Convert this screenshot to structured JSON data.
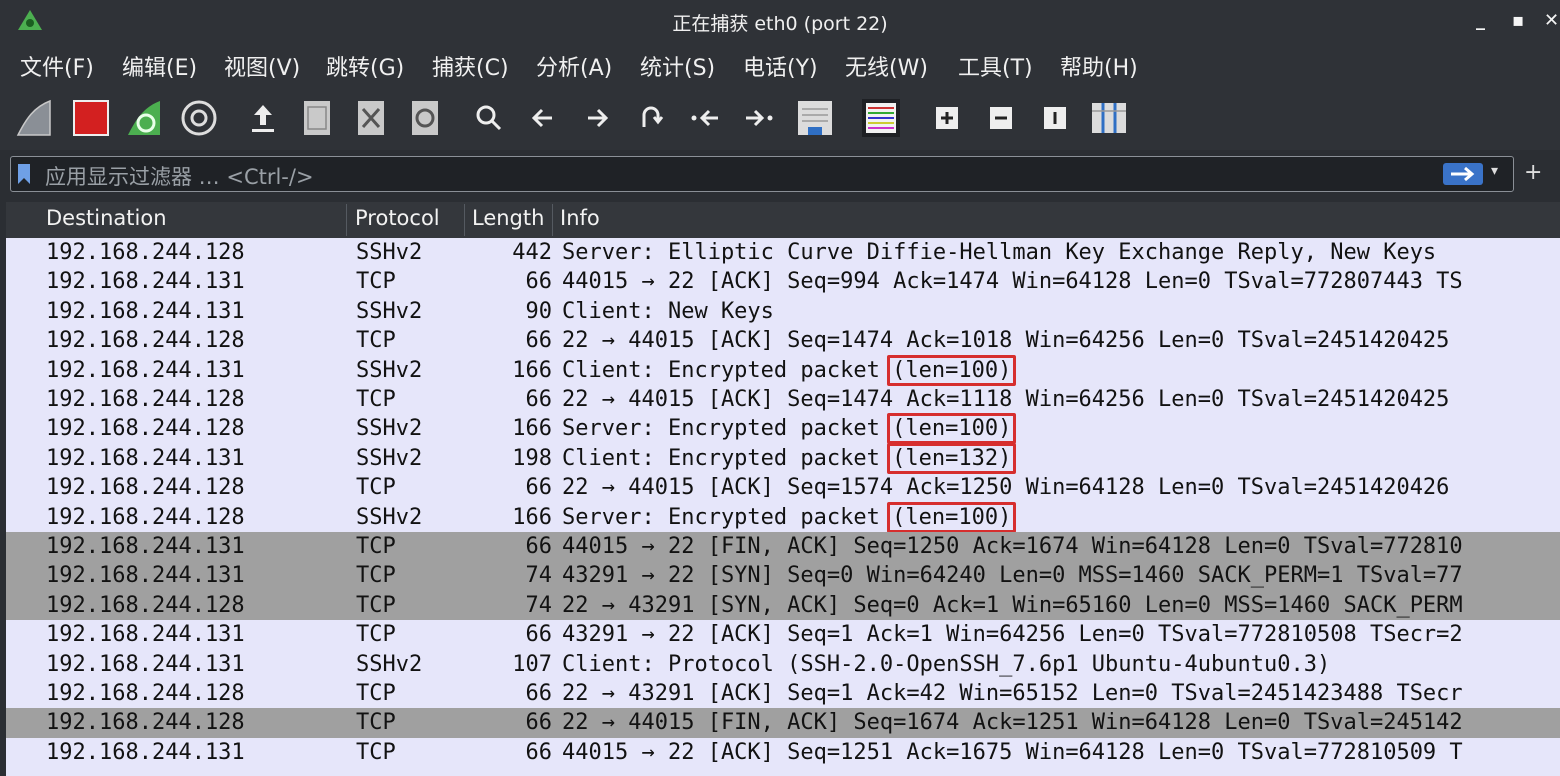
{
  "window": {
    "title": "正在捕获 eth0 (port 22)",
    "controls": {
      "minimize": "_",
      "maximize": "▪",
      "close": "✕"
    }
  },
  "menu": [
    "文件(F)",
    "编辑(E)",
    "视图(V)",
    "跳转(G)",
    "捕获(C)",
    "分析(A)",
    "统计(S)",
    "电话(Y)",
    "无线(W)",
    "工具(T)",
    "帮助(H)"
  ],
  "toolbar": [
    "shark-fin-icon",
    "stop-capture-icon",
    "restart-capture-icon",
    "capture-options-icon",
    "open-file-icon",
    "save-file-icon",
    "close-file-icon",
    "reload-file-icon",
    "find-packet-icon",
    "go-back-icon",
    "go-forward-icon",
    "go-to-packet-icon",
    "go-first-packet-icon",
    "go-last-packet-icon",
    "auto-scroll-icon",
    "colorize-icon",
    "zoom-in-icon",
    "zoom-out-icon",
    "normal-size-icon",
    "resize-columns-icon"
  ],
  "filter": {
    "placeholder": "应用显示过滤器 … <Ctrl-/>",
    "add_label": "+"
  },
  "packet_list": {
    "columns": [
      "Destination",
      "Protocol",
      "Length",
      "Info"
    ],
    "rows": [
      {
        "dst": "192.168.244.128",
        "proto": "SSHv2",
        "len": "442",
        "info": "Server: Elliptic Curve Diffie-Hellman Key Exchange Reply, New Keys",
        "mark": "",
        "gray": false
      },
      {
        "dst": "192.168.244.131",
        "proto": "TCP",
        "len": "66",
        "info": "44015 → 22 [ACK] Seq=994 Ack=1474 Win=64128 Len=0 TSval=772807443 TS",
        "mark": "",
        "gray": false
      },
      {
        "dst": "192.168.244.131",
        "proto": "SSHv2",
        "len": "90",
        "info": "Client: New Keys",
        "mark": "",
        "gray": false
      },
      {
        "dst": "192.168.244.128",
        "proto": "TCP",
        "len": "66",
        "info": "22 → 44015 [ACK] Seq=1474 Ack=1018 Win=64256 Len=0 TSval=2451420425",
        "mark": "",
        "gray": false
      },
      {
        "dst": "192.168.244.131",
        "proto": "SSHv2",
        "len": "166",
        "info": "Client: Encrypted packet ",
        "mark": "(len=100)",
        "gray": false
      },
      {
        "dst": "192.168.244.128",
        "proto": "TCP",
        "len": "66",
        "info": "22 → 44015 [ACK] Seq=1474 Ack=1118 Win=64256 Len=0 TSval=2451420425",
        "mark": "",
        "gray": false
      },
      {
        "dst": "192.168.244.128",
        "proto": "SSHv2",
        "len": "166",
        "info": "Server: Encrypted packet ",
        "mark": "(len=100)",
        "gray": false
      },
      {
        "dst": "192.168.244.131",
        "proto": "SSHv2",
        "len": "198",
        "info": "Client: Encrypted packet ",
        "mark": "(len=132)",
        "gray": false
      },
      {
        "dst": "192.168.244.128",
        "proto": "TCP",
        "len": "66",
        "info": "22 → 44015 [ACK] Seq=1574 Ack=1250 Win=64128 Len=0 TSval=2451420426",
        "mark": "",
        "gray": false
      },
      {
        "dst": "192.168.244.128",
        "proto": "SSHv2",
        "len": "166",
        "info": "Server: Encrypted packet ",
        "mark": "(len=100)",
        "gray": false
      },
      {
        "dst": "192.168.244.131",
        "proto": "TCP",
        "len": "66",
        "info": "44015 → 22 [FIN, ACK] Seq=1250 Ack=1674 Win=64128 Len=0 TSval=772810",
        "mark": "",
        "gray": true
      },
      {
        "dst": "192.168.244.131",
        "proto": "TCP",
        "len": "74",
        "info": "43291 → 22 [SYN] Seq=0 Win=64240 Len=0 MSS=1460 SACK_PERM=1 TSval=77",
        "mark": "",
        "gray": true
      },
      {
        "dst": "192.168.244.128",
        "proto": "TCP",
        "len": "74",
        "info": "22 → 43291 [SYN, ACK] Seq=0 Ack=1 Win=65160 Len=0 MSS=1460 SACK_PERM",
        "mark": "",
        "gray": true
      },
      {
        "dst": "192.168.244.131",
        "proto": "TCP",
        "len": "66",
        "info": "43291 → 22 [ACK] Seq=1 Ack=1 Win=64256 Len=0 TSval=772810508 TSecr=2",
        "mark": "",
        "gray": false
      },
      {
        "dst": "192.168.244.131",
        "proto": "SSHv2",
        "len": "107",
        "info": "Client: Protocol (SSH-2.0-OpenSSH_7.6p1 Ubuntu-4ubuntu0.3)",
        "mark": "",
        "gray": false
      },
      {
        "dst": "192.168.244.128",
        "proto": "TCP",
        "len": "66",
        "info": "22 → 43291 [ACK] Seq=1 Ack=42 Win=65152 Len=0 TSval=2451423488 TSecr",
        "mark": "",
        "gray": false
      },
      {
        "dst": "192.168.244.128",
        "proto": "TCP",
        "len": "66",
        "info": "22 → 44015 [FIN, ACK] Seq=1674 Ack=1251 Win=64128 Len=0 TSval=245142",
        "mark": "",
        "gray": true
      },
      {
        "dst": "192.168.244.131",
        "proto": "TCP",
        "len": "66",
        "info": "44015 → 22 [ACK] Seq=1251 Ack=1675 Win=64128 Len=0 TSval=772810509 T",
        "mark": "",
        "gray": false
      }
    ]
  },
  "colors": {
    "list_background": "#e6e6fa",
    "gray_row": "#a0a0a0",
    "highlight_box": "#d62e2e",
    "chrome": "#2f3237"
  }
}
